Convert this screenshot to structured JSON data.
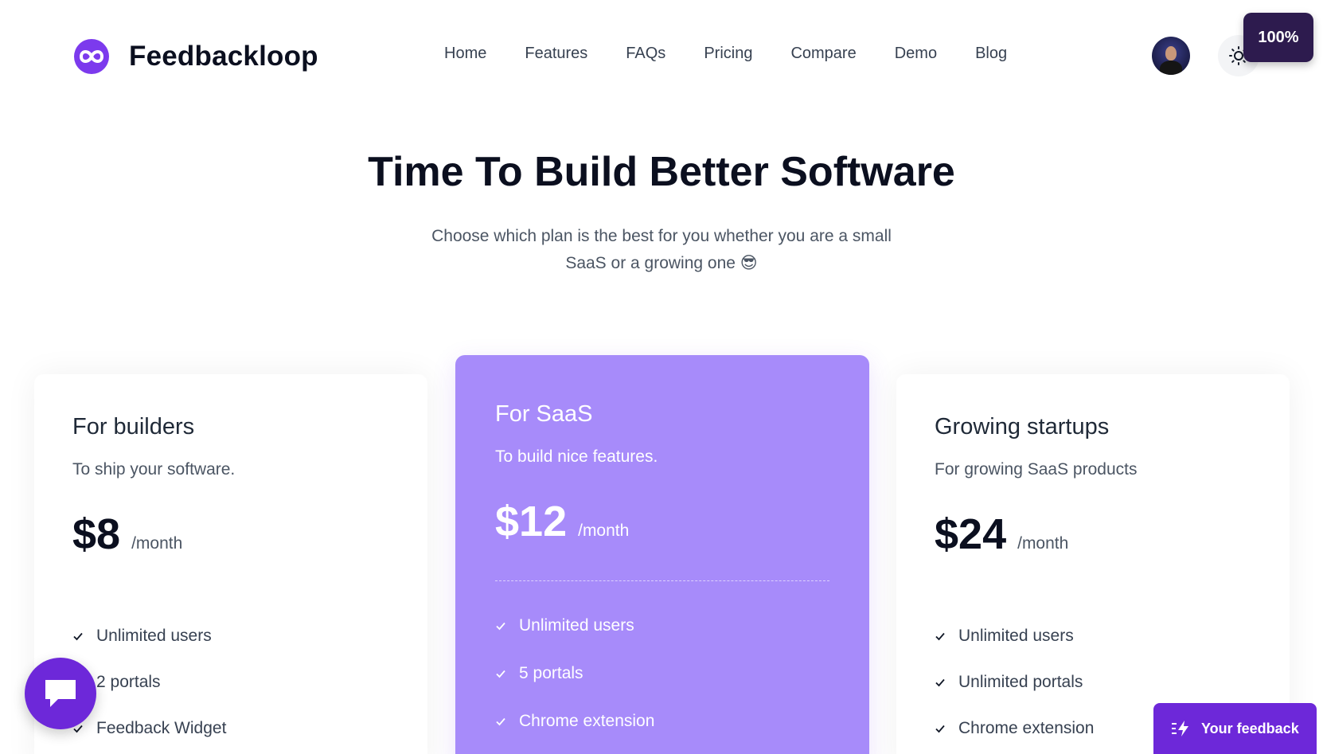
{
  "brand": {
    "name": "Feedbackloop",
    "logo_icon": "infinity-loop-icon",
    "accent": "#7c3aed"
  },
  "nav": {
    "items": [
      "Home",
      "Features",
      "FAQs",
      "Pricing",
      "Compare",
      "Demo",
      "Blog"
    ]
  },
  "header": {
    "zoom": "100%",
    "theme_icon": "sun-icon",
    "avatar": "user-avatar"
  },
  "hero": {
    "title": "Time To Build Better Software",
    "subtitle": "Choose which plan is the best for you whether you are a small SaaS or a growing one 😎"
  },
  "plans": [
    {
      "name": "For builders",
      "description": "To ship your software.",
      "price": "$8",
      "period": "/month",
      "features": [
        "Unlimited users",
        "2 portals",
        "Feedback Widget"
      ]
    },
    {
      "name": "For SaaS",
      "description": "To build nice features.",
      "price": "$12",
      "period": "/month",
      "features": [
        "Unlimited users",
        "5 portals",
        "Chrome extension"
      ],
      "highlight_color": "#a78bfa"
    },
    {
      "name": "Growing startups",
      "description": "For growing SaaS products",
      "price": "$24",
      "period": "/month",
      "features": [
        "Unlimited users",
        "Unlimited portals",
        "Chrome extension"
      ]
    }
  ],
  "widgets": {
    "chat_icon": "chat-bubble-icon",
    "feedback_label": "Your feedback",
    "feedback_icon": "lightning-icon"
  }
}
